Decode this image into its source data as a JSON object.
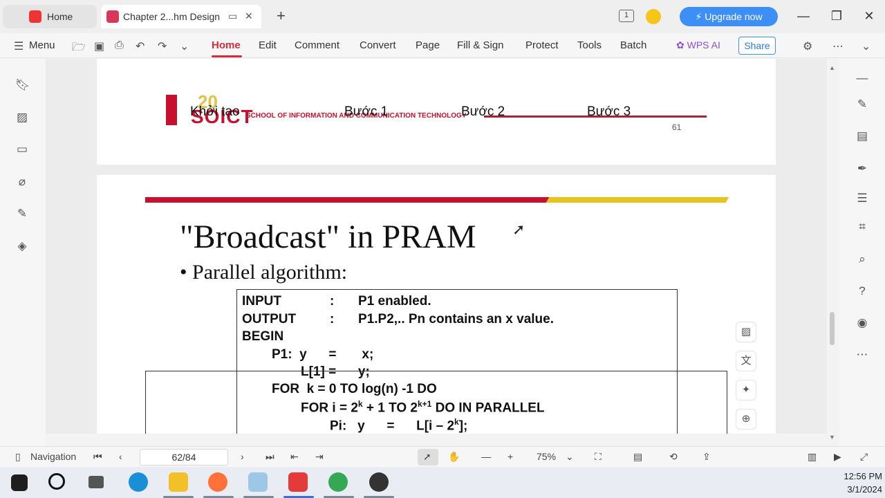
{
  "tabs": {
    "home_label": "Home",
    "doc_label": "Chapter 2...hm Design"
  },
  "titlebar": {
    "upgrade_label": "Upgrade now",
    "badge_count": "1"
  },
  "menu": {
    "menu_label": "Menu",
    "items": [
      "Home",
      "Edit",
      "Comment",
      "Convert",
      "Page",
      "Fill & Sign",
      "Protect",
      "Tools",
      "Batch"
    ],
    "wps_ai": "WPS AI",
    "share": "Share"
  },
  "page1": {
    "logo_text": "SOICT",
    "logo_number": "20",
    "school": "SCHOOL OF INFORMATION AND COMMUNICATION TECHNOLOGY",
    "steps": [
      "Khởi tạo",
      "Bước 1",
      "Bước 2",
      "Bước 3"
    ],
    "page_number": "61"
  },
  "page2": {
    "title": "\"Broadcast\" in PRAM",
    "bullet": "• Parallel algorithm:",
    "code": {
      "input_kw": "INPUT",
      "colon": ":",
      "input_val": "P1 enabled.",
      "output_kw": "OUTPUT",
      "output_val": "P1.P2,.. Pn contains an x value.",
      "begin": "BEGIN",
      "p1": "P1:  y      =       x;",
      "l1": "L[1] =      y;",
      "for1": "FOR  k = 0 TO log(n) -1 DO",
      "for2_a": "FOR i = 2",
      "for2_sup1": "k",
      "for2_b": " + 1 TO 2",
      "for2_sup2": "k+1",
      "for2_c": " DO IN PARALLEL",
      "pi_a": "Pi:   y      =      L[i – 2",
      "pi_sup": "k",
      "pi_b": "];"
    }
  },
  "status": {
    "navigation": "Navigation",
    "page_input": "62/84",
    "zoom": "75%"
  },
  "clock": {
    "time": "12:56 PM",
    "date": "3/1/2024"
  }
}
